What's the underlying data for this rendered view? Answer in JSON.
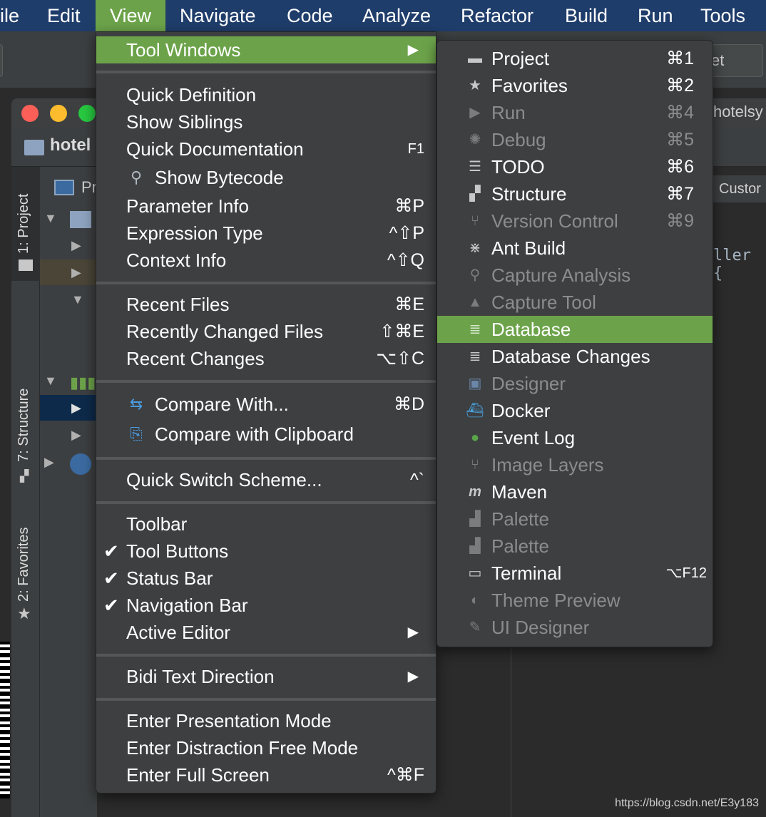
{
  "menubar": {
    "items": [
      {
        "label": "ile"
      },
      {
        "label": "Edit"
      },
      {
        "label": "View"
      },
      {
        "label": "Navigate"
      },
      {
        "label": "Code"
      },
      {
        "label": "Analyze"
      },
      {
        "label": "Refactor"
      },
      {
        "label": "Build"
      },
      {
        "label": "Run"
      },
      {
        "label": "Tools"
      }
    ]
  },
  "background": {
    "project_name": "hotel",
    "right_field_text": "et",
    "window_title_fragment": "hotelsy",
    "vertical_tabs": [
      "1: Project",
      "7: Structure",
      "2: Favorites"
    ],
    "project_panel_label": "Pr",
    "editor_tab": "Custor",
    "code_fragment": "ller {"
  },
  "view_menu": {
    "tool_windows": {
      "label": "Tool Windows"
    },
    "group1": [
      {
        "label": "Quick Definition",
        "shortcut": ""
      },
      {
        "label": "Show Siblings",
        "shortcut": ""
      },
      {
        "label": "Quick Documentation",
        "shortcut": "F1"
      },
      {
        "label": "Show Bytecode",
        "shortcut": ""
      },
      {
        "label": "Parameter Info",
        "shortcut": "⌘P"
      },
      {
        "label": "Expression Type",
        "shortcut": "^⇧P"
      },
      {
        "label": "Context Info",
        "shortcut": "^⇧Q"
      }
    ],
    "group2": [
      {
        "label": "Recent Files",
        "shortcut": "⌘E"
      },
      {
        "label": "Recently Changed Files",
        "shortcut": "⇧⌘E"
      },
      {
        "label": "Recent Changes",
        "shortcut": "⌥⇧C"
      }
    ],
    "group3": [
      {
        "label": "Compare With...",
        "shortcut": "⌘D"
      },
      {
        "label": "Compare with Clipboard",
        "shortcut": ""
      }
    ],
    "group4": [
      {
        "label": "Quick Switch Scheme...",
        "shortcut": "^`"
      }
    ],
    "group5": [
      {
        "label": "Toolbar",
        "checked": false
      },
      {
        "label": "Tool Buttons",
        "checked": true
      },
      {
        "label": "Status Bar",
        "checked": true
      },
      {
        "label": "Navigation Bar",
        "checked": true
      },
      {
        "label": "Active Editor",
        "checked": false
      }
    ],
    "group6": [
      {
        "label": "Bidi Text Direction"
      }
    ],
    "group7": [
      {
        "label": "Enter Presentation Mode",
        "shortcut": ""
      },
      {
        "label": "Enter Distraction Free Mode",
        "shortcut": ""
      },
      {
        "label": "Enter Full Screen",
        "shortcut": "^⌘F"
      }
    ]
  },
  "tool_windows_menu": {
    "items": [
      {
        "label": "Project",
        "shortcut": "⌘1",
        "icon": "folder-icon",
        "enabled": true
      },
      {
        "label": "Favorites",
        "shortcut": "⌘2",
        "icon": "star-icon",
        "enabled": true
      },
      {
        "label": "Run",
        "shortcut": "⌘4",
        "icon": "run-icon",
        "enabled": false
      },
      {
        "label": "Debug",
        "shortcut": "⌘5",
        "icon": "bug-icon",
        "enabled": false
      },
      {
        "label": "TODO",
        "shortcut": "⌘6",
        "icon": "list-icon",
        "enabled": true
      },
      {
        "label": "Structure",
        "shortcut": "⌘7",
        "icon": "structure-icon",
        "enabled": true
      },
      {
        "label": "Version Control",
        "shortcut": "⌘9",
        "icon": "vcs-icon",
        "enabled": false
      },
      {
        "label": "Ant Build",
        "shortcut": "",
        "icon": "ant-icon",
        "enabled": true
      },
      {
        "label": "Capture Analysis",
        "shortcut": "",
        "icon": "magnifier-icon",
        "enabled": false
      },
      {
        "label": "Capture Tool",
        "shortcut": "",
        "icon": "warning-icon",
        "enabled": false
      },
      {
        "label": "Database",
        "shortcut": "",
        "icon": "database-icon",
        "enabled": true,
        "highlighted": true
      },
      {
        "label": "Database Changes",
        "shortcut": "",
        "icon": "database-changes-icon",
        "enabled": true
      },
      {
        "label": "Designer",
        "shortcut": "",
        "icon": "designer-icon",
        "enabled": false
      },
      {
        "label": "Docker",
        "shortcut": "",
        "icon": "docker-icon",
        "enabled": true
      },
      {
        "label": "Event Log",
        "shortcut": "",
        "icon": "event-log-icon",
        "enabled": true
      },
      {
        "label": "Image Layers",
        "shortcut": "",
        "icon": "layers-icon",
        "enabled": false
      },
      {
        "label": "Maven",
        "shortcut": "",
        "icon": "maven-icon",
        "enabled": true
      },
      {
        "label": "Palette",
        "shortcut": "",
        "icon": "palette-icon",
        "enabled": false
      },
      {
        "label": "Palette",
        "shortcut": "",
        "icon": "palette-icon",
        "enabled": false
      },
      {
        "label": "Terminal",
        "shortcut": "⌥F12",
        "icon": "terminal-icon",
        "enabled": true
      },
      {
        "label": "Theme Preview",
        "shortcut": "",
        "icon": "theme-icon",
        "enabled": false
      },
      {
        "label": "UI Designer",
        "shortcut": "",
        "icon": "ui-designer-icon",
        "enabled": false
      }
    ]
  },
  "watermark": "https://blog.csdn.net/E3y183",
  "colors": {
    "menubar": "#1f3d6b",
    "highlight": "#6ca34a",
    "menu_bg": "#3d3f41",
    "disabled_text": "#8a8c8e"
  }
}
